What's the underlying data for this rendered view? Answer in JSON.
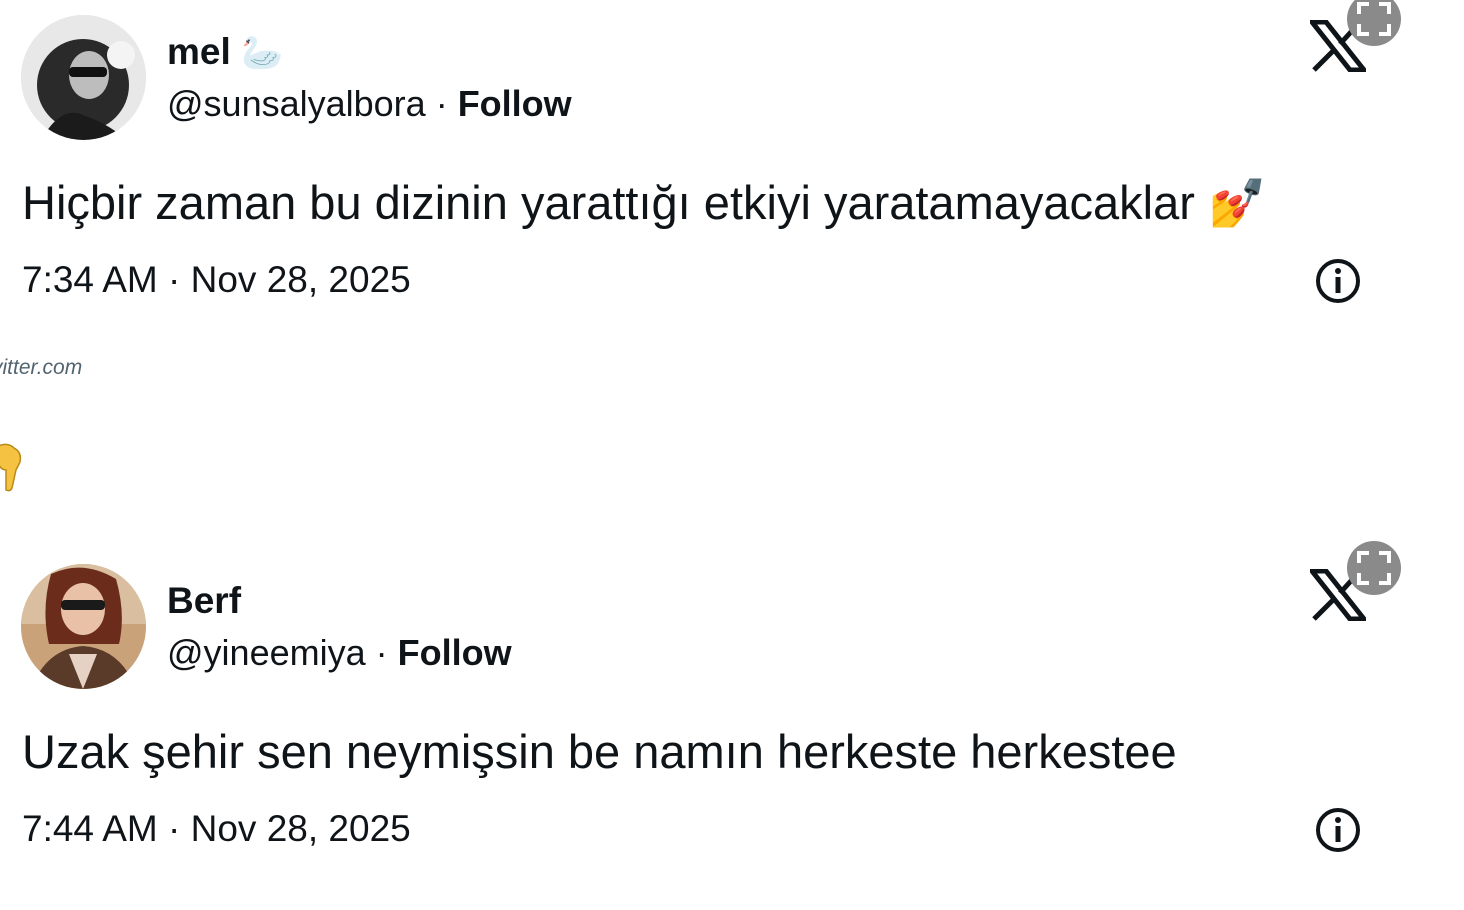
{
  "tweets": [
    {
      "display_name": "mel",
      "name_emoji": "🦢",
      "handle": "@sunsalyalbora",
      "separator": "·",
      "follow_label": "Follow",
      "text": "Hiçbir zaman bu dizinin yarattığı etkiyi yaratamayacaklar",
      "text_emoji": "💅",
      "timestamp": "7:34 AM · Nov 28, 2025"
    },
    {
      "display_name": "Berf",
      "handle": "@yineemiya",
      "separator": "·",
      "follow_label": "Follow",
      "text": "Uzak şehir sen neymişsin be namın herkeste herkestee",
      "timestamp": "7:44 AM · Nov 28, 2025"
    }
  ],
  "source_text": "vitter.com",
  "icons": {
    "brand": "x-logo-icon",
    "expand": "expand-icon",
    "info": "info-icon",
    "pointing": "pointing-down-emoji"
  },
  "colors": {
    "text": "#0f1419",
    "secondary": "#536471",
    "expand_bg": "#8a8a8a"
  }
}
